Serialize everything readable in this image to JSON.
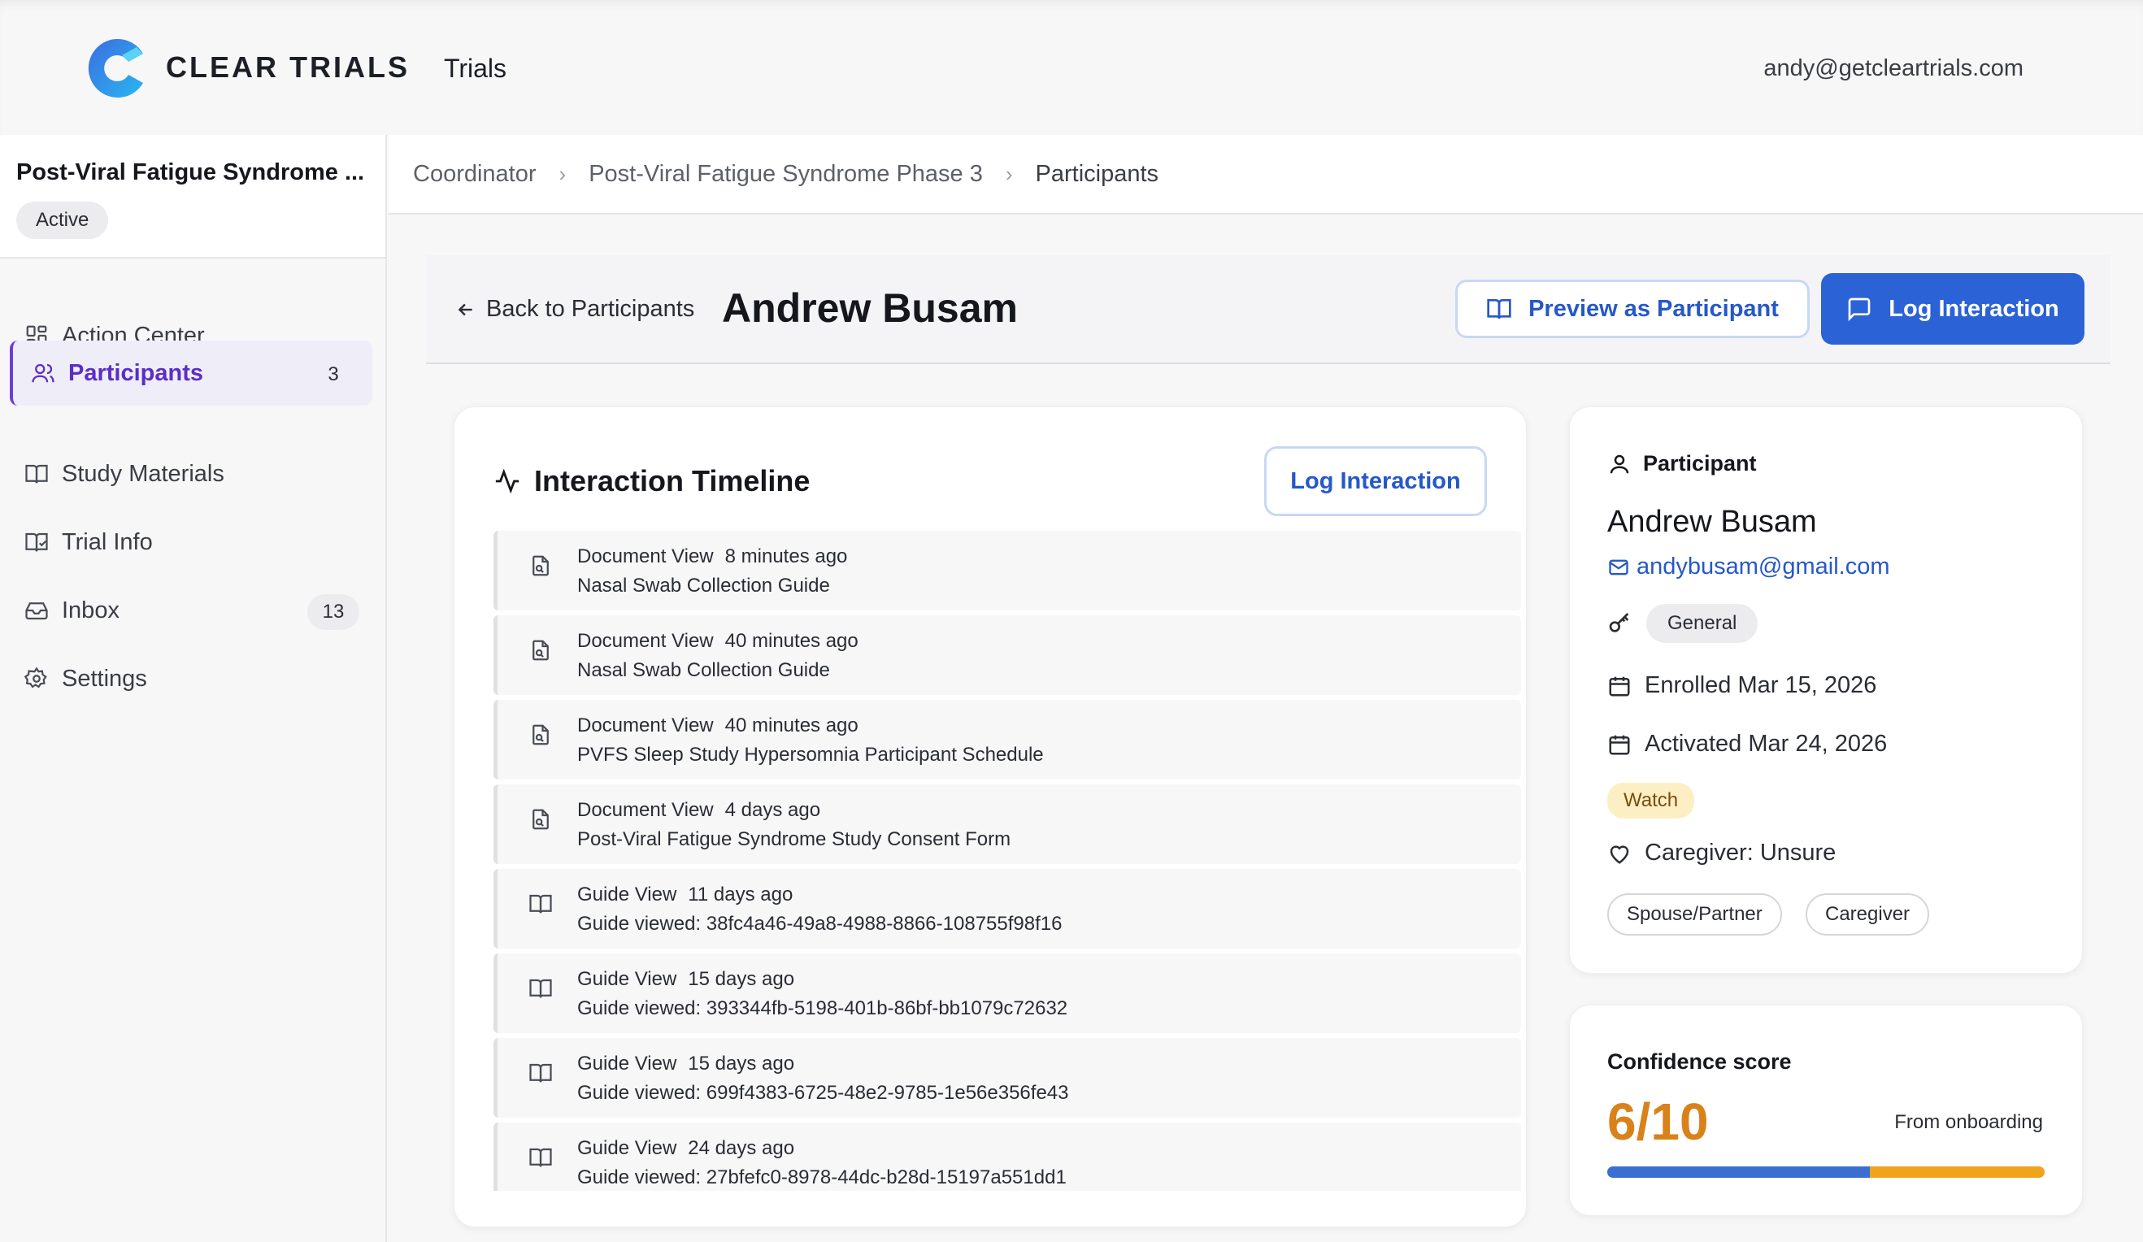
{
  "app": {
    "brand": "CLEAR TRIALS",
    "nav_trials": "Trials",
    "user_email": "andy@getcleartrials.com"
  },
  "sidebar": {
    "study_name": "Post-Viral Fatigue Syndrome ...",
    "study_status": "Active",
    "items": [
      {
        "label": "Action Center",
        "icon": "grid-icon"
      },
      {
        "label": "Participants",
        "icon": "users-icon",
        "count": "3",
        "active": true
      },
      {
        "label": "Study Materials",
        "icon": "book-icon"
      },
      {
        "label": "Trial Info",
        "icon": "book-check-icon"
      },
      {
        "label": "Inbox",
        "icon": "inbox-icon",
        "count": "13"
      },
      {
        "label": "Settings",
        "icon": "gear-icon"
      }
    ]
  },
  "breadcrumb": [
    "Coordinator",
    "Post-Viral Fatigue Syndrome Phase 3",
    "Participants"
  ],
  "header": {
    "back_label": "Back to Participants",
    "title": "Andrew Busam",
    "preview_label": "Preview as Participant",
    "log_label": "Log Interaction"
  },
  "timeline": {
    "title": "Interaction Timeline",
    "log_label": "Log Interaction",
    "items": [
      {
        "type": "Document View",
        "time": "8 minutes ago",
        "detail": "Nasal Swab Collection Guide",
        "icon": "document-icon"
      },
      {
        "type": "Document View",
        "time": "40 minutes ago",
        "detail": "Nasal Swab Collection Guide",
        "icon": "document-icon"
      },
      {
        "type": "Document View",
        "time": "40 minutes ago",
        "detail": "PVFS Sleep Study Hypersomnia Participant Schedule",
        "icon": "document-icon"
      },
      {
        "type": "Document View",
        "time": "4 days ago",
        "detail": "Post-Viral Fatigue Syndrome Study Consent Form",
        "icon": "document-icon"
      },
      {
        "type": "Guide View",
        "time": "11 days ago",
        "detail": "Guide viewed: 38fc4a46-49a8-4988-8866-108755f98f16",
        "icon": "book-icon"
      },
      {
        "type": "Guide View",
        "time": "15 days ago",
        "detail": "Guide viewed: 393344fb-5198-401b-86bf-bb1079c72632",
        "icon": "book-icon"
      },
      {
        "type": "Guide View",
        "time": "15 days ago",
        "detail": "Guide viewed: 699f4383-6725-48e2-9785-1e56e356fe43",
        "icon": "book-icon"
      },
      {
        "type": "Guide View",
        "time": "24 days ago",
        "detail": "Guide viewed: 27bfefc0-8978-44dc-b28d-15197a551dd1",
        "icon": "book-icon"
      }
    ]
  },
  "participant": {
    "section_label": "Participant",
    "name": "Andrew Busam",
    "email": "andybusam@gmail.com",
    "access_tag": "General",
    "enrolled": "Enrolled Mar 15, 2026",
    "activated": "Activated Mar 24, 2026",
    "watch_badge": "Watch",
    "caregiver": "Caregiver: Unsure",
    "chips": [
      "Spouse/Partner",
      "Caregiver"
    ]
  },
  "confidence": {
    "title": "Confidence score",
    "score": "6/10",
    "score_value": 6,
    "score_max": 10,
    "source": "From onboarding"
  },
  "colors": {
    "accent_blue": "#2b62d6",
    "active_purple": "#5b2ec6",
    "score_orange": "#d9821a",
    "watch_bg": "#fcefc4"
  }
}
